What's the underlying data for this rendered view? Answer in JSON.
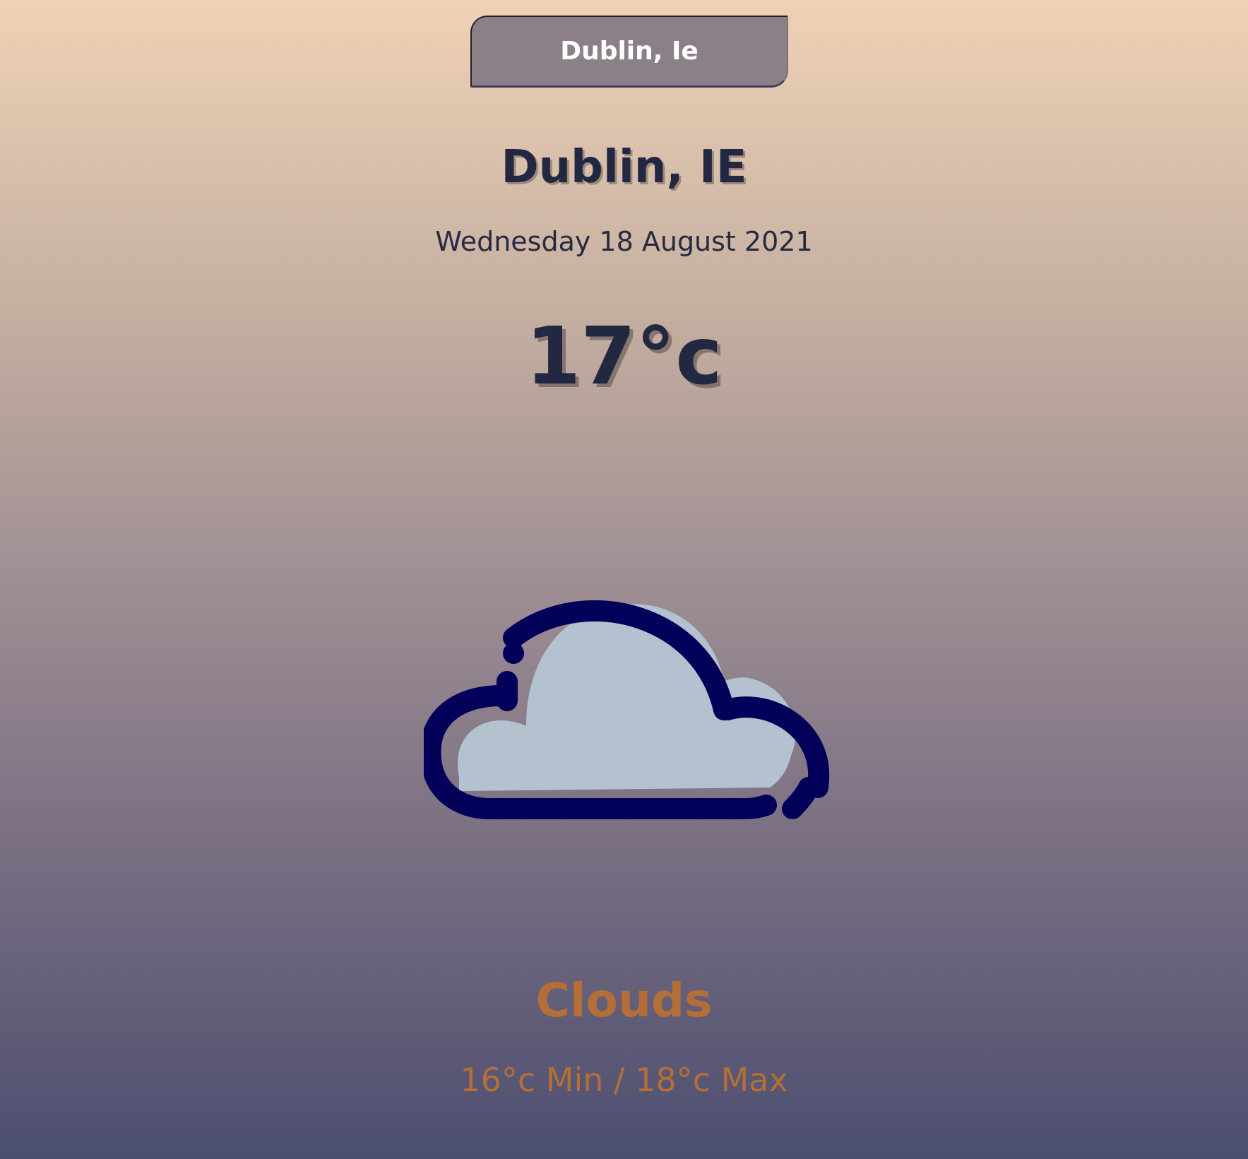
{
  "search": {
    "value": "Dublin, Ie"
  },
  "location": {
    "city": "Dublin, IE",
    "date": "Wednesday 18 August 2021"
  },
  "weather": {
    "temperature": "17°c",
    "condition": "Clouds",
    "hi_low": "16°c Min / 18°c Max",
    "icon": "cloud-icon"
  },
  "colors": {
    "primary_text": "#232842",
    "accent": "#b46e36",
    "cloud_fill": "#b4c2cf",
    "cloud_outline": "#03005a",
    "search_bg": "#8c8088"
  }
}
